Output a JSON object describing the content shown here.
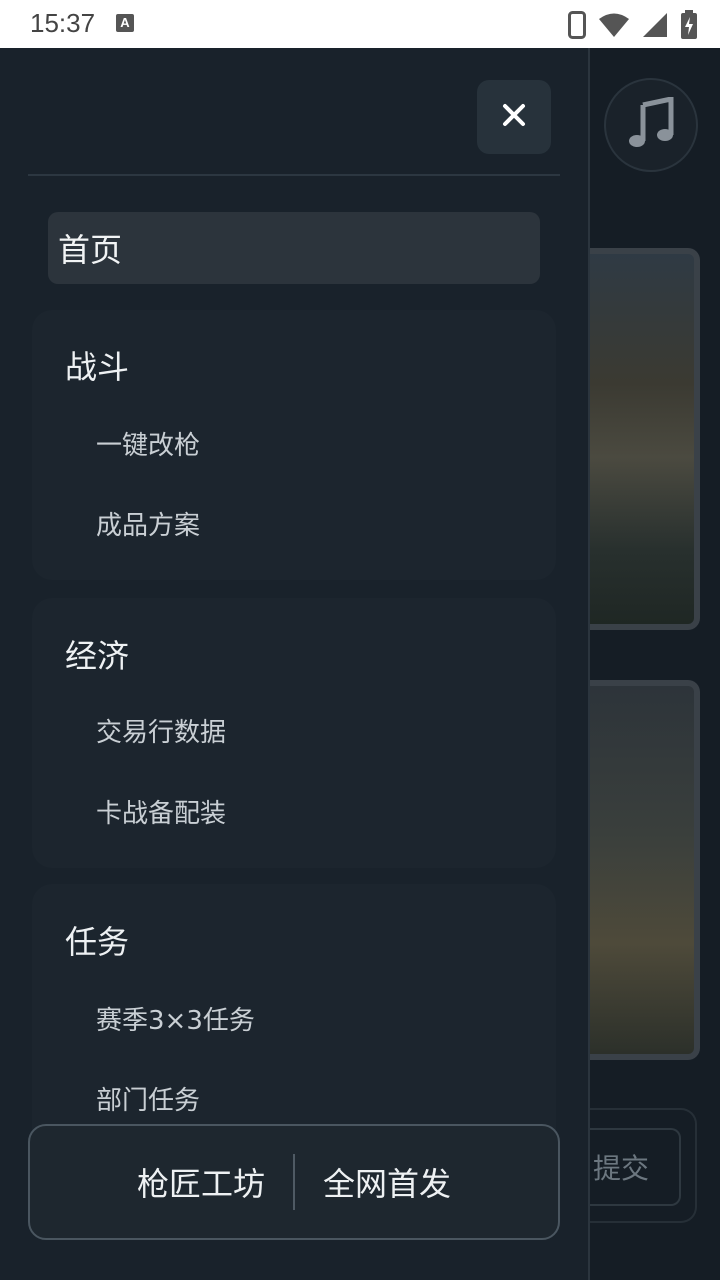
{
  "status_bar": {
    "time": "15:37",
    "notification_icon": "A"
  },
  "background_app": {
    "music_icon": "music-note-icon",
    "submit_label": "提交"
  },
  "drawer": {
    "close_icon": "close-icon",
    "home": "首页",
    "sections": [
      {
        "title": "战斗",
        "items": [
          "一键改枪",
          "成品方案"
        ]
      },
      {
        "title": "经济",
        "items": [
          "交易行数据",
          "卡战备配装"
        ]
      },
      {
        "title": "任务",
        "items": [
          "赛季3×3任务",
          "部门任务"
        ]
      }
    ],
    "bottom": {
      "left": "枪匠工坊",
      "right": "全网首发"
    }
  }
}
